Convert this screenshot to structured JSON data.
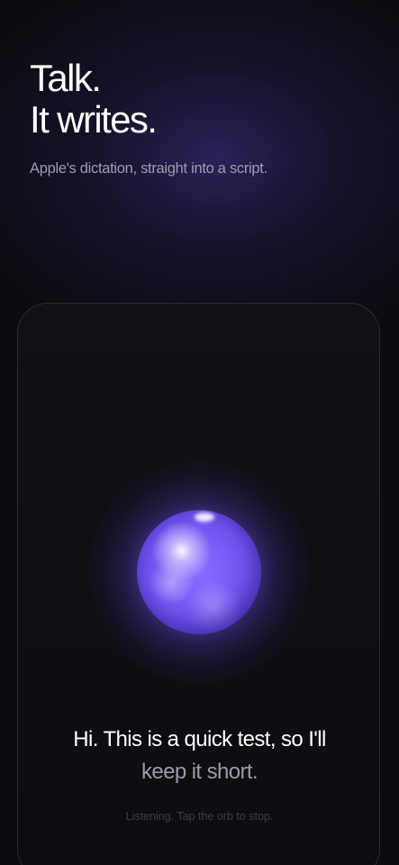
{
  "hero": {
    "headline_line1": "Talk.",
    "headline_line2": "It writes.",
    "subtitle": "Apple's dictation, straight into a script."
  },
  "dictation": {
    "orb_icon": "dictation-orb",
    "transcript_line1": "Hi. This is a quick test, so I'll",
    "transcript_line2": "keep it short.",
    "hint": "Listening. Tap the orb to stop."
  },
  "colors": {
    "background": "#0c0b10",
    "accent_orb": "#7454f2",
    "glow": "#483494",
    "text_primary": "#ffffff",
    "text_secondary": "#9e9aae"
  }
}
